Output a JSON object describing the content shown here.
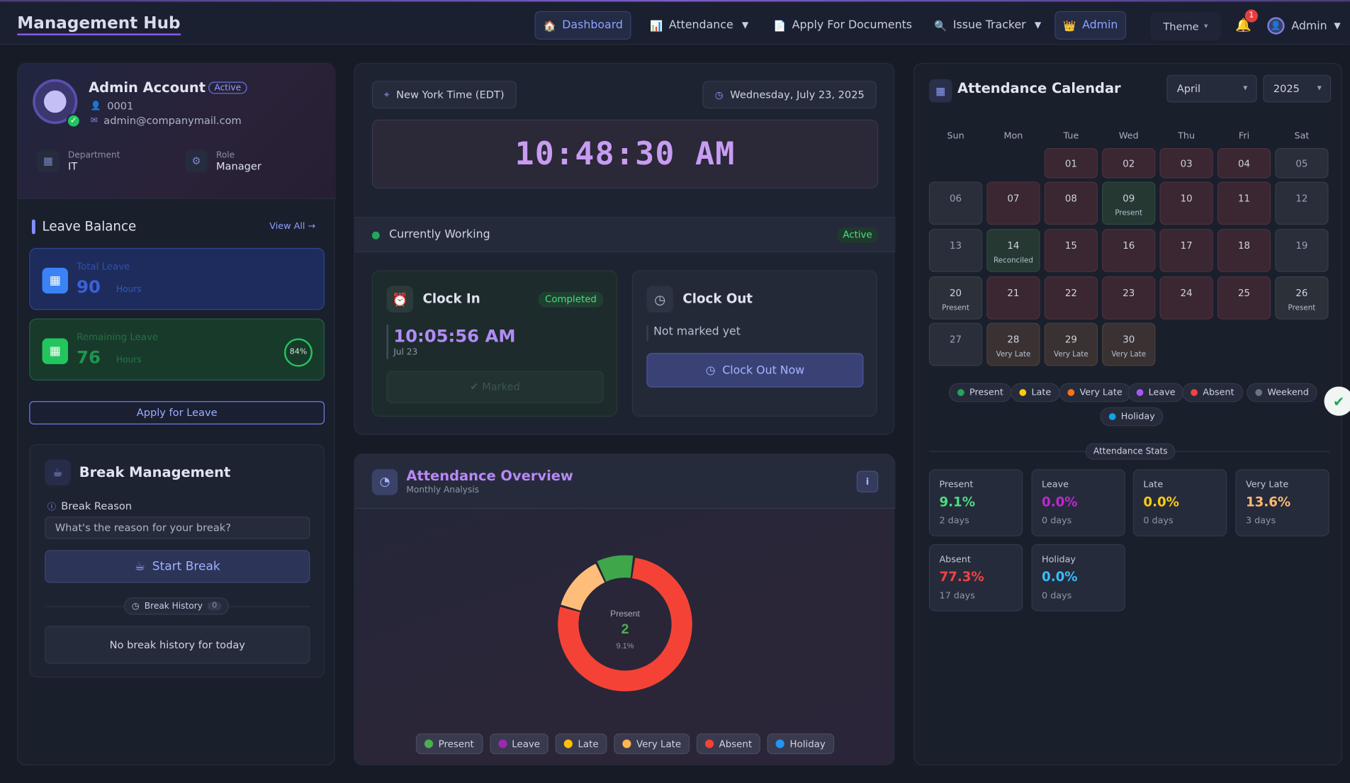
{
  "header": {
    "brand": "Management Hub",
    "nav": [
      {
        "label": "Dashboard",
        "icon": "home-icon"
      },
      {
        "label": "Attendance",
        "icon": "chart-icon"
      },
      {
        "label": "Apply For Documents",
        "icon": "document-icon"
      },
      {
        "label": "Issue Tracker",
        "icon": "search-icon"
      },
      {
        "label": "Admin",
        "icon": "crown-icon"
      }
    ],
    "theme_label": "Theme",
    "notification_count": "1",
    "user_label": "Admin"
  },
  "profile": {
    "name": "Admin Account",
    "status_badge": "Active",
    "employee_id": "0001",
    "email": "admin@companymail.com",
    "department_label": "Department",
    "department": "IT",
    "role_label": "Role",
    "role": "Manager"
  },
  "leave": {
    "title": "Leave Balance",
    "view_all": "View All",
    "total_label": "Total Leave",
    "total_value": "90",
    "total_unit": "Hours",
    "remaining_label": "Remaining Leave",
    "remaining_value": "76",
    "remaining_unit": "Hours",
    "remaining_percent": "84%",
    "apply_label": "Apply for Leave"
  },
  "break": {
    "title": "Break Management",
    "reason_label": "Break Reason",
    "reason_placeholder": "What's the reason for your break?",
    "start_label": "Start Break",
    "history_label": "Break History",
    "history_count": "0",
    "empty_text": "No break history for today"
  },
  "clock": {
    "timezone": "New York Time (EDT)",
    "date": "Wednesday, July 23, 2025",
    "time": "10:48:30 AM",
    "working_label": "Currently Working",
    "working_badge": "Active",
    "clock_in_title": "Clock In",
    "clock_in_status": "Completed",
    "clock_in_time": "10:05:56 AM",
    "clock_in_date": "Jul 23",
    "clock_in_button": "Marked",
    "clock_out_title": "Clock Out",
    "clock_out_status": "Not marked yet",
    "clock_out_button": "Clock Out Now"
  },
  "overview": {
    "title": "Attendance Overview",
    "subtitle": "Monthly Analysis",
    "center_label": "Present",
    "center_value": "2",
    "center_percent": "9.1%",
    "legend": [
      {
        "label": "Present",
        "color": "#4caf50"
      },
      {
        "label": "Leave",
        "color": "#9c27b0"
      },
      {
        "label": "Late",
        "color": "#ffc107"
      },
      {
        "label": "Very Late",
        "color": "#ffb74d"
      },
      {
        "label": "Absent",
        "color": "#f44336"
      },
      {
        "label": "Holiday",
        "color": "#2196f3"
      }
    ]
  },
  "chart_data": {
    "type": "pie",
    "categories": [
      "Present",
      "Leave",
      "Late",
      "Very Late",
      "Absent",
      "Holiday"
    ],
    "values": [
      2,
      0,
      0,
      3,
      17,
      0
    ],
    "colors": [
      "#3fa64a",
      "#9c27b0",
      "#ffc107",
      "#ffbd7a",
      "#f44336",
      "#2196f3"
    ]
  },
  "calendar": {
    "title": "Attendance Calendar",
    "month": "April",
    "year": "2025",
    "weekdays": [
      "Sun",
      "Mon",
      "Tue",
      "Wed",
      "Thu",
      "Fri",
      "Sat"
    ],
    "days": [
      {
        "n": "01",
        "s": "",
        "t": "absent"
      },
      {
        "n": "02",
        "s": "",
        "t": "absent"
      },
      {
        "n": "03",
        "s": "",
        "t": "absent"
      },
      {
        "n": "04",
        "s": "",
        "t": "absent"
      },
      {
        "n": "05",
        "s": "",
        "t": "weekend"
      },
      {
        "n": "06",
        "s": "",
        "t": "weekend"
      },
      {
        "n": "07",
        "s": "",
        "t": "absent"
      },
      {
        "n": "08",
        "s": "",
        "t": "absent"
      },
      {
        "n": "09",
        "s": "Present",
        "t": "present"
      },
      {
        "n": "10",
        "s": "",
        "t": "absent"
      },
      {
        "n": "11",
        "s": "",
        "t": "absent"
      },
      {
        "n": "12",
        "s": "",
        "t": "weekend"
      },
      {
        "n": "13",
        "s": "",
        "t": "weekend"
      },
      {
        "n": "14",
        "s": "Reconciled",
        "t": "present"
      },
      {
        "n": "15",
        "s": "",
        "t": "absent"
      },
      {
        "n": "16",
        "s": "",
        "t": "absent"
      },
      {
        "n": "17",
        "s": "",
        "t": "absent"
      },
      {
        "n": "18",
        "s": "",
        "t": "absent"
      },
      {
        "n": "19",
        "s": "",
        "t": "weekend"
      },
      {
        "n": "20",
        "s": "Present",
        "t": "wkpresent"
      },
      {
        "n": "21",
        "s": "",
        "t": "absent"
      },
      {
        "n": "22",
        "s": "",
        "t": "absent"
      },
      {
        "n": "23",
        "s": "",
        "t": "absent"
      },
      {
        "n": "24",
        "s": "",
        "t": "absent"
      },
      {
        "n": "25",
        "s": "",
        "t": "absent"
      },
      {
        "n": "26",
        "s": "Present",
        "t": "wkpresent"
      },
      {
        "n": "27",
        "s": "",
        "t": "weekend"
      },
      {
        "n": "28",
        "s": "Very Late",
        "t": "verylate"
      },
      {
        "n": "29",
        "s": "Very Late",
        "t": "verylate"
      },
      {
        "n": "30",
        "s": "Very Late",
        "t": "verylate"
      }
    ],
    "legend": [
      {
        "label": "Present",
        "color": "#22a55e"
      },
      {
        "label": "Late",
        "color": "#facc15"
      },
      {
        "label": "Very Late",
        "color": "#f97316"
      },
      {
        "label": "Leave",
        "color": "#a855f7"
      },
      {
        "label": "Absent",
        "color": "#ef4444"
      },
      {
        "label": "Weekend",
        "color": "#6b7280"
      },
      {
        "label": "Holiday",
        "color": "#0ea5e9"
      }
    ],
    "stats_label": "Attendance Stats",
    "stats": [
      {
        "label": "Present",
        "value": "9.1%",
        "days": "2 days",
        "color": "#4ade80"
      },
      {
        "label": "Leave",
        "value": "0.0%",
        "days": "0 days",
        "color": "#c026d3"
      },
      {
        "label": "Late",
        "value": "0.0%",
        "days": "0 days",
        "color": "#facc15"
      },
      {
        "label": "Very Late",
        "value": "13.6%",
        "days": "3 days",
        "color": "#fdba74"
      },
      {
        "label": "Absent",
        "value": "77.3%",
        "days": "17 days",
        "color": "#ef4444"
      },
      {
        "label": "Holiday",
        "value": "0.0%",
        "days": "0 days",
        "color": "#38bdf8"
      }
    ]
  }
}
